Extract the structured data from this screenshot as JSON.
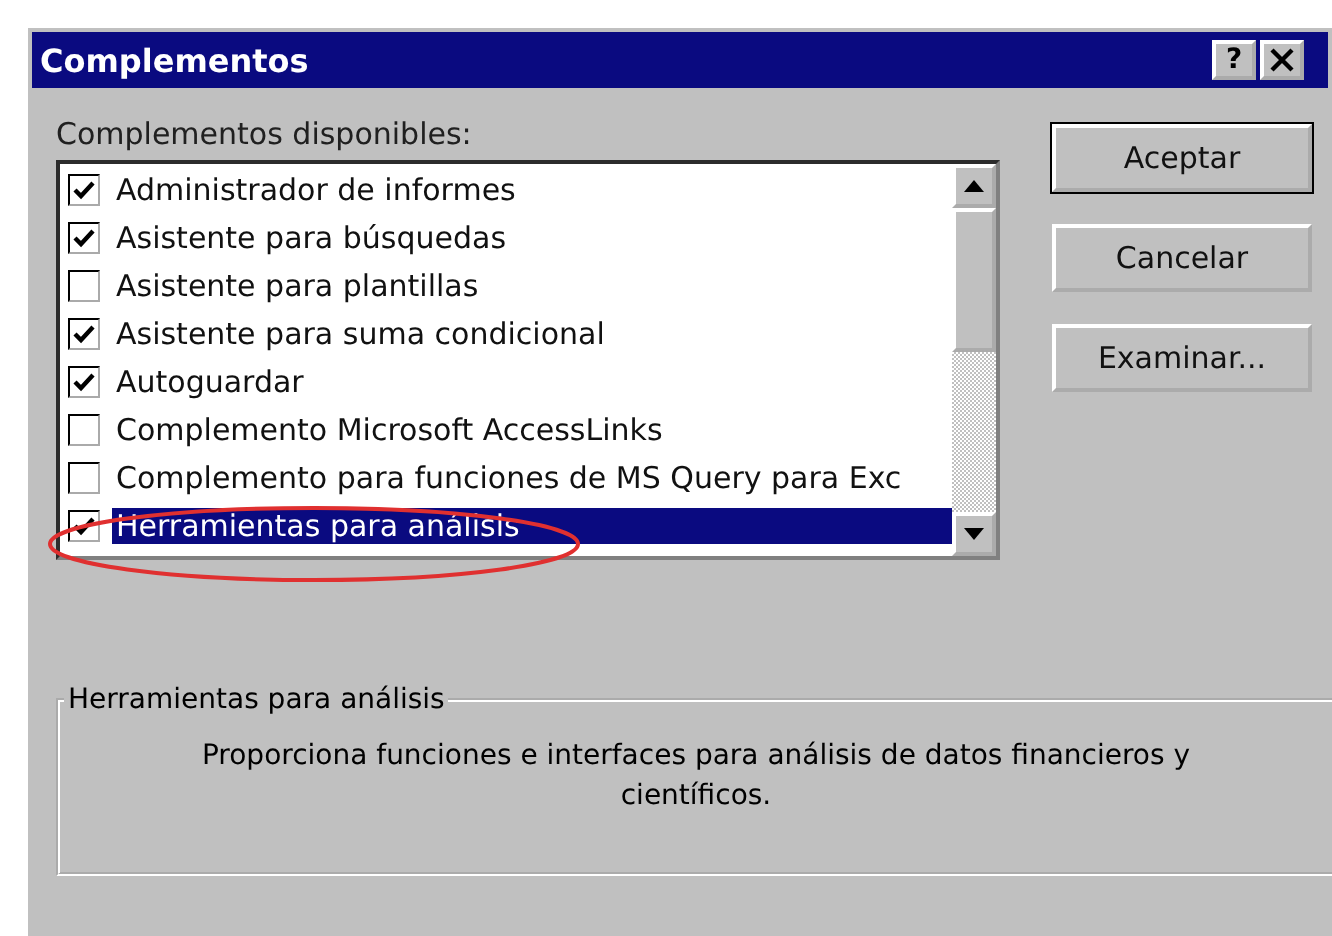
{
  "window": {
    "title": "Complementos",
    "help": "?"
  },
  "list_label": "Complementos disponibles:",
  "items": [
    {
      "label": "Administrador de informes",
      "checked": true,
      "selected": false
    },
    {
      "label": "Asistente para búsquedas",
      "checked": true,
      "selected": false
    },
    {
      "label": "Asistente para plantillas",
      "checked": false,
      "selected": false
    },
    {
      "label": "Asistente para suma condicional",
      "checked": true,
      "selected": false
    },
    {
      "label": "Autoguardar",
      "checked": true,
      "selected": false
    },
    {
      "label": "Complemento Microsoft AccessLinks",
      "checked": false,
      "selected": false
    },
    {
      "label": "Complemento para funciones de MS Query para Exc",
      "checked": false,
      "selected": false
    },
    {
      "label": "Herramientas para análisis",
      "checked": true,
      "selected": true
    }
  ],
  "buttons": [
    "Aceptar",
    "Cancelar",
    "Examinar..."
  ],
  "description": {
    "title": "Herramientas para análisis",
    "text": "Proporciona funciones e interfaces para análisis de datos financieros y científicos."
  }
}
